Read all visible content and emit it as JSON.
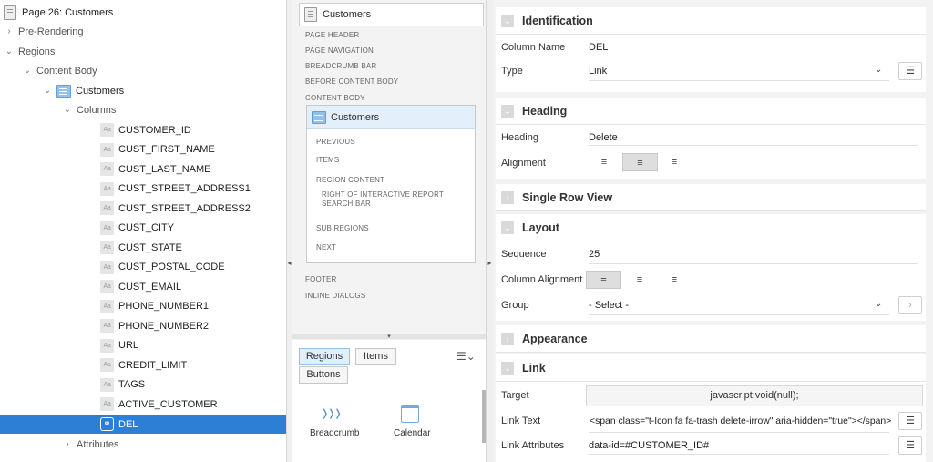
{
  "tree": {
    "page_title": "Page 26: Customers",
    "pre_rendering": "Pre-Rendering",
    "regions": "Regions",
    "content_body": "Content Body",
    "customers": "Customers",
    "columns": "Columns",
    "column_items": [
      "CUSTOMER_ID",
      "CUST_FIRST_NAME",
      "CUST_LAST_NAME",
      "CUST_STREET_ADDRESS1",
      "CUST_STREET_ADDRESS2",
      "CUST_CITY",
      "CUST_STATE",
      "CUST_POSTAL_CODE",
      "CUST_EMAIL",
      "PHONE_NUMBER1",
      "PHONE_NUMBER2",
      "URL",
      "CREDIT_LIMIT",
      "TAGS",
      "ACTIVE_CUSTOMER"
    ],
    "selected": "DEL",
    "attributes": "Attributes",
    "col_icon_text": "Aa"
  },
  "layout": {
    "top_card": "Customers",
    "sections": [
      "PAGE HEADER",
      "PAGE NAVIGATION",
      "BREADCRUMB BAR",
      "BEFORE CONTENT BODY",
      "CONTENT BODY"
    ],
    "region_card": "Customers",
    "region_slots": [
      "PREVIOUS",
      "ITEMS",
      "REGION CONTENT",
      "RIGHT OF INTERACTIVE REPORT",
      "SEARCH BAR",
      "SUB REGIONS",
      "NEXT"
    ],
    "after": [
      "FOOTER",
      "INLINE DIALOGS"
    ]
  },
  "gallery": {
    "tabs": [
      "Regions",
      "Items",
      "Buttons"
    ],
    "active_tab": "Regions",
    "items": [
      "Breadcrumb",
      "Calendar"
    ]
  },
  "props": {
    "identification": {
      "title": "Identification",
      "column_name_label": "Column Name",
      "column_name": "DEL",
      "type_label": "Type",
      "type": "Link"
    },
    "heading": {
      "title": "Heading",
      "heading_label": "Heading",
      "heading": "Delete",
      "alignment_label": "Alignment",
      "alignment": "center"
    },
    "single_row_view": {
      "title": "Single Row View"
    },
    "layout": {
      "title": "Layout",
      "sequence_label": "Sequence",
      "sequence": "25",
      "column_alignment_label": "Column Alignment",
      "column_alignment": "start",
      "group_label": "Group",
      "group": "- Select -"
    },
    "appearance": {
      "title": "Appearance"
    },
    "link": {
      "title": "Link",
      "target_label": "Target",
      "target": "javascript:void(null);",
      "link_text_label": "Link Text",
      "link_text": "<span class=\"t-Icon fa fa-trash delete-irrow\" aria-hidden=\"true\"></span>",
      "link_attributes_label": "Link Attributes",
      "link_attributes": "data-id=#CUSTOMER_ID#"
    }
  }
}
